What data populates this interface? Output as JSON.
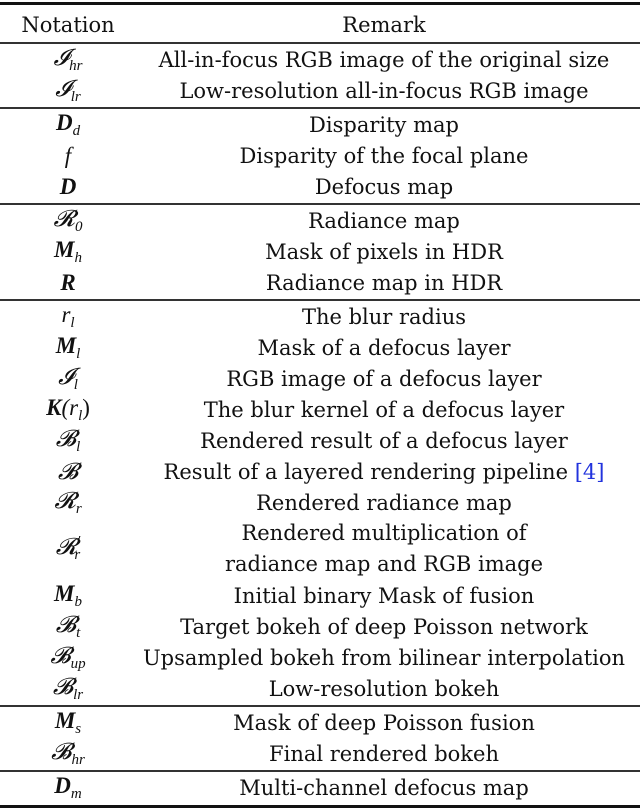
{
  "table": {
    "headers": {
      "notation": "Notation",
      "remark": "Remark"
    },
    "groups": [
      [
        {
          "base": "𝓘",
          "sub": "hr",
          "bold": false,
          "remark": "All-in-focus RGB image of the original size"
        },
        {
          "base": "𝓘",
          "sub": "lr",
          "bold": false,
          "remark": "Low-resolution all-in-focus RGB image"
        }
      ],
      [
        {
          "base": "D",
          "sub": "d",
          "bold": true,
          "remark": "Disparity map"
        },
        {
          "base": "f",
          "sub": "",
          "bold": false,
          "remark": "Disparity of the focal plane"
        },
        {
          "base": "D",
          "sub": "",
          "bold": true,
          "remark": "Defocus map"
        }
      ],
      [
        {
          "base": "𝓡",
          "sub": "0",
          "bold": false,
          "remark": "Radiance map"
        },
        {
          "base": "M",
          "sub": "h",
          "bold": true,
          "remark": "Mask of pixels in HDR"
        },
        {
          "base": "R",
          "sub": "",
          "bold": true,
          "remark": "Radiance map in HDR"
        }
      ],
      [
        {
          "base": "r",
          "sub": "l",
          "bold": false,
          "remark": "The blur radius"
        },
        {
          "base": "M",
          "sub": "l",
          "bold": true,
          "remark": "Mask of a defocus layer"
        },
        {
          "base": "𝓘",
          "sub": "l",
          "bold": false,
          "remark": "RGB image of a defocus layer"
        },
        {
          "base": "K",
          "sub": "",
          "bold": true,
          "arg": "(r",
          "argsub": "l",
          "argclose": ")",
          "remark": "The blur kernel of a defocus layer"
        },
        {
          "base": "𝓑",
          "sub": "l",
          "bold": false,
          "remark": "Rendered result of a defocus layer"
        },
        {
          "base": "𝓑",
          "sub": "",
          "bold": false,
          "remark": "Result of a layered rendering pipeline",
          "cite": "[4]"
        },
        {
          "base": "𝓡",
          "sub": "r",
          "bold": false,
          "remark": "Rendered radiance map"
        },
        {
          "base": "𝓡",
          "sub": "r",
          "sup": "′",
          "bold": false,
          "remark": "Rendered multiplication of",
          "remark2": "radiance map and RGB image"
        },
        {
          "base": "M",
          "sub": "b",
          "bold": true,
          "remark": "Initial binary Mask of fusion"
        },
        {
          "base": "𝓑",
          "sub": "t",
          "bold": false,
          "remark": "Target bokeh of deep Poisson network"
        },
        {
          "base": "𝓑",
          "sub": "up",
          "bold": false,
          "remark": "Upsampled bokeh from bilinear interpolation"
        },
        {
          "base": "𝓑",
          "sub": "lr",
          "bold": false,
          "remark": "Low-resolution bokeh"
        }
      ],
      [
        {
          "base": "M",
          "sub": "s",
          "bold": true,
          "remark": "Mask of deep Poisson fusion"
        },
        {
          "base": "𝓑",
          "sub": "hr",
          "bold": false,
          "remark": "Final rendered bokeh"
        }
      ],
      [
        {
          "base": "D",
          "sub": "m",
          "bold": true,
          "remark": "Multi-channel defocus map"
        }
      ]
    ],
    "colors": {
      "text": "#111111",
      "citation": "#2233dd",
      "rule": "#111111"
    }
  }
}
